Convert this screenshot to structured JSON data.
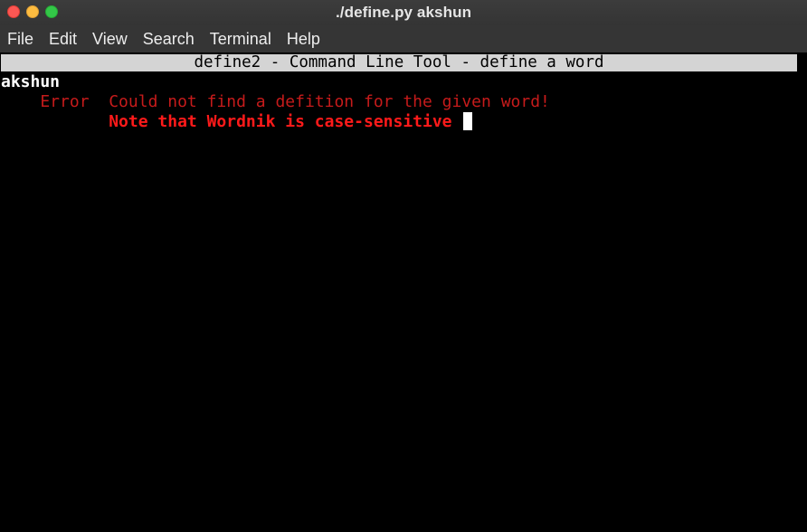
{
  "window": {
    "title": "./define.py akshun"
  },
  "menubar": {
    "items": [
      "File",
      "Edit",
      "View",
      "Search",
      "Terminal",
      "Help"
    ]
  },
  "terminal": {
    "header": "define2 - Command Line Tool - define a word",
    "word": "akshun",
    "error_prefix": "    Error  ",
    "error_message": "Could not find a defition for the given word!",
    "note_indent": "           ",
    "note_message": "Note that Wordnik is case-sensitive"
  },
  "colors": {
    "background": "#000000",
    "header_bg": "#d4d4d4",
    "error_text": "#c61b1b",
    "note_text": "#ff1a1a"
  }
}
